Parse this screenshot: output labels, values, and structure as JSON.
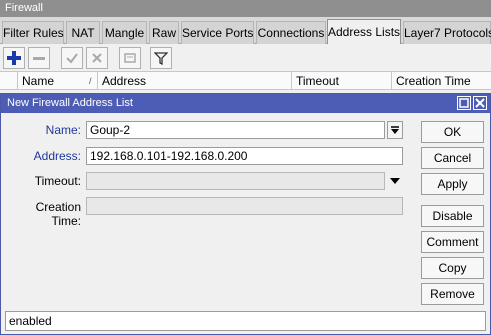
{
  "window": {
    "title": "Firewall"
  },
  "tabs": [
    {
      "label": "Filter Rules"
    },
    {
      "label": "NAT"
    },
    {
      "label": "Mangle"
    },
    {
      "label": "Raw"
    },
    {
      "label": "Service Ports"
    },
    {
      "label": "Connections"
    },
    {
      "label": "Address Lists",
      "active": true
    },
    {
      "label": "Layer7 Protocols"
    }
  ],
  "toolbar": {
    "buttons": [
      "add-icon",
      "remove-icon",
      "enable-icon",
      "disable-icon",
      "comment-icon",
      "filter-icon"
    ]
  },
  "table": {
    "columns": [
      "Name",
      "Address",
      "Timeout",
      "Creation Time"
    ]
  },
  "dialog": {
    "title": "New Firewall Address List",
    "fields": {
      "name": {
        "label": "Name:",
        "value": "Goup-2"
      },
      "address": {
        "label": "Address:",
        "value": "192.168.0.101-192.168.0.200"
      },
      "timeout": {
        "label": "Timeout:",
        "value": ""
      },
      "creation_time": {
        "label": "Creation Time:",
        "value": ""
      }
    },
    "buttons": {
      "ok": "OK",
      "cancel": "Cancel",
      "apply": "Apply",
      "disable": "Disable",
      "comment": "Comment",
      "copy": "Copy",
      "remove": "Remove"
    },
    "status": "enabled"
  },
  "colors": {
    "dialog_title_bg": "#4d5db5",
    "window_title_bg": "#8f8f8f",
    "label_blue": "#1d3a9c"
  }
}
